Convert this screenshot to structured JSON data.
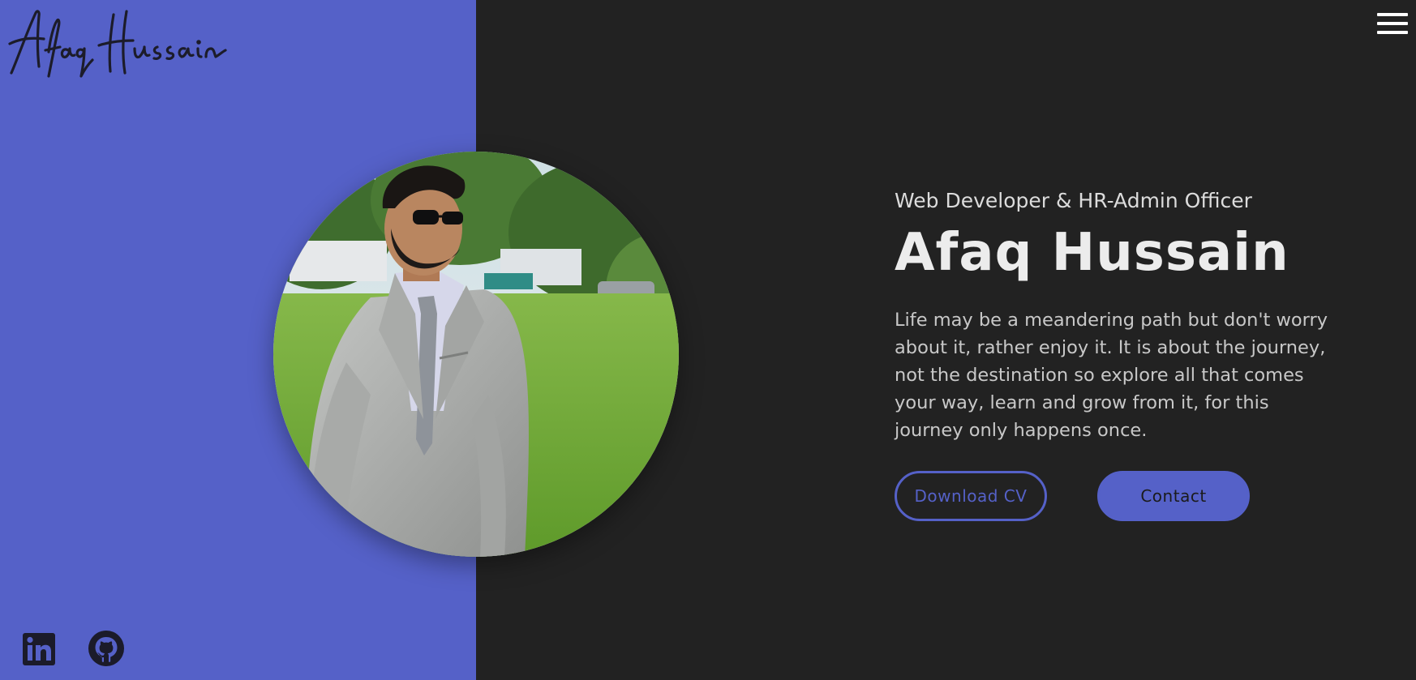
{
  "brand": {
    "logo_text": "Afaq Hussain",
    "accent_color": "#5561c8",
    "background_dark": "#222222"
  },
  "nav": {
    "menu_icon": "hamburger-menu-icon"
  },
  "hero": {
    "subtitle": "Web Developer & HR-Admin Officer",
    "name": "Afaq Hussain",
    "bio": "Life may be a meandering path but don't worry about it, rather enjoy it. It is about the journey, not the destination so explore all that comes your way, learn and grow from it, for this journey only happens once.",
    "buttons": {
      "download_cv": "Download CV",
      "contact": "Contact"
    }
  },
  "social": [
    {
      "icon": "linkedin-icon"
    },
    {
      "icon": "github-icon"
    }
  ]
}
